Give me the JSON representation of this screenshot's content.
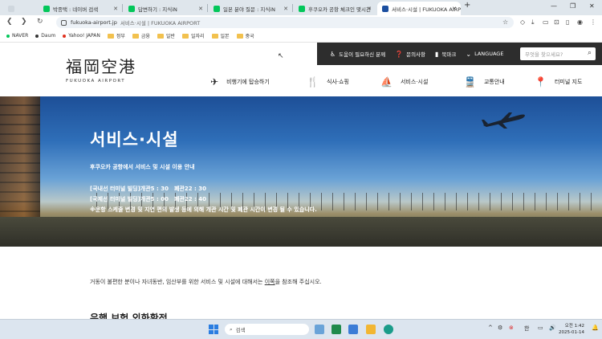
{
  "browser": {
    "tabs": [
      {
        "label": "박종택 : 네이버 검색",
        "color": "#03c75a"
      },
      {
        "label": "답변하기 : 지식iN",
        "color": "#03c75a"
      },
      {
        "label": "일본 분야 질문 : 지식iN",
        "color": "#03c75a"
      },
      {
        "label": "후쿠오카 공항 체크인 몇시간",
        "color": "#03c75a"
      },
      {
        "label": "서비스·시설 | FUKUOKA AIRP",
        "color": "#1b4fa0"
      }
    ],
    "new_tab": "+",
    "window_controls": {
      "minimize": "—",
      "maximize": "❐",
      "close": "✕"
    },
    "url": "fukuoka-airport.jp",
    "page_title": "서비스·시설 | FUKUOKA AIRPORT"
  },
  "bookmarks": [
    {
      "label": "NAVER",
      "type": "dot",
      "color": "#03c75a"
    },
    {
      "label": "Daum",
      "type": "dot",
      "color": "#333333"
    },
    {
      "label": "Yahoo! JAPAN",
      "type": "dot",
      "color": "#e0301e"
    },
    {
      "label": "정부",
      "type": "folder"
    },
    {
      "label": "금융",
      "type": "folder"
    },
    {
      "label": "일반",
      "type": "folder"
    },
    {
      "label": "일자리",
      "type": "folder"
    },
    {
      "label": "일본",
      "type": "folder"
    },
    {
      "label": "중국",
      "type": "folder"
    }
  ],
  "site": {
    "logo_kanji": "福岡空港",
    "logo_english": "FUKUOKA AIRPORT",
    "utility": [
      {
        "icon": "wheelchair-icon",
        "label": "도움이 필요하신 분께"
      },
      {
        "icon": "question-icon",
        "label": "문의사항"
      },
      {
        "icon": "bookmark-icon",
        "label": "북마크"
      },
      {
        "icon": "language-icon",
        "label": "LANGUAGE"
      }
    ],
    "search_placeholder": "무엇을 찾으세요?",
    "nav": [
      {
        "icon": "airplane-icon",
        "label": "비행기에 탑승하기"
      },
      {
        "icon": "fork-knife-icon",
        "label": "식사·쇼핑"
      },
      {
        "icon": "service-icon",
        "label": "서비스·시설"
      },
      {
        "icon": "train-icon",
        "label": "교통안내"
      },
      {
        "icon": "map-pin-icon",
        "label": "터미널 지도"
      }
    ]
  },
  "hero": {
    "title": "서비스·시설",
    "subtitle": "후쿠오카 공항에서 서비스 및 시설 이용 안내",
    "lines": [
      "[국내선 터미널 빌딩]개관5 : 30　폐관22 : 30",
      "[국제선 터미널 빌딩]개관5 : 00　폐관22 : 40",
      "※운항 스케줄 변경 및 지연 편의 발생 등에 의해 개관 시간 및 폐관 시간이 변경 될 수 있습니다."
    ]
  },
  "content": {
    "intro_before": "거동이 불편한 분이나 자녀동반, 임산부를 위한 서비스 및 시설에 대해서는 ",
    "intro_link": "이쪽",
    "intro_after": "을 참조해 주십시오.",
    "section_title": "은행 보험 외화환전"
  },
  "taskbar": {
    "search_placeholder": "검색",
    "ime": "한",
    "time": "오전 1:42",
    "date": "2025-01-14"
  }
}
